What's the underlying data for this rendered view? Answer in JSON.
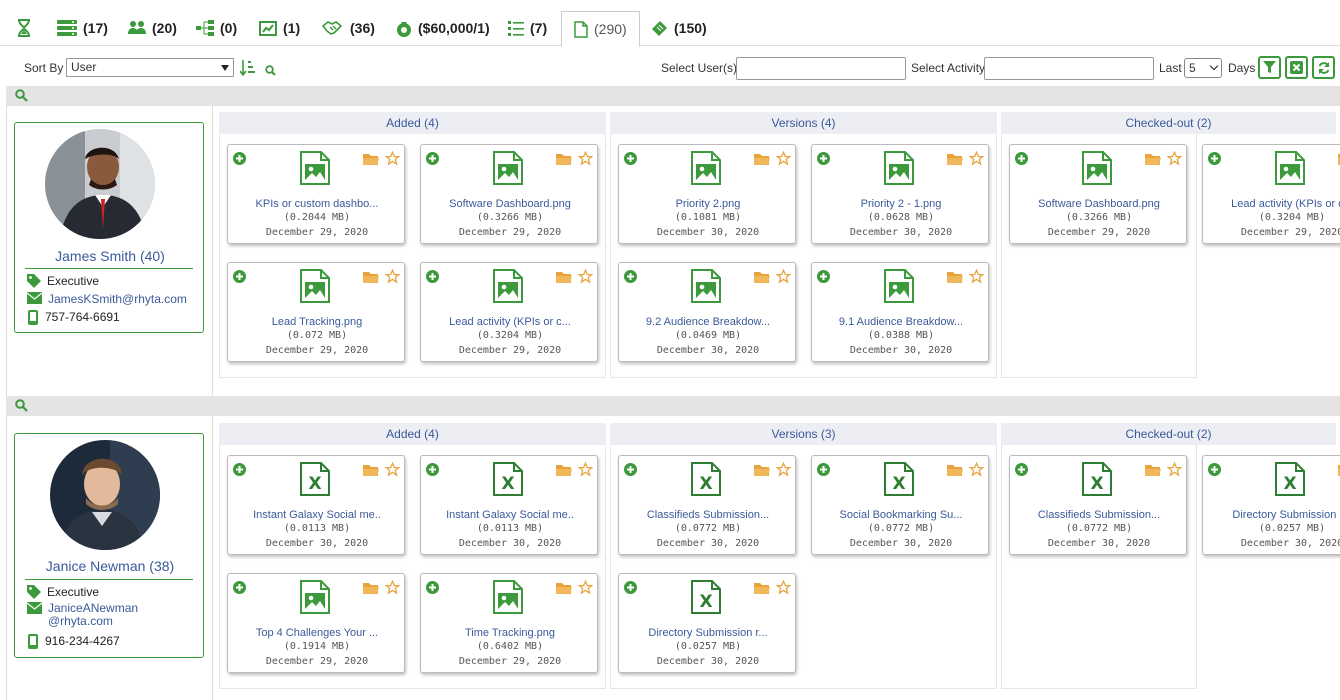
{
  "tabs": [
    {
      "icon": "hourglass-icon",
      "count": ""
    },
    {
      "icon": "list-stack-icon",
      "count": "(17)"
    },
    {
      "icon": "users-icon",
      "count": "(20)"
    },
    {
      "icon": "hierarchy-icon",
      "count": "(0)"
    },
    {
      "icon": "chart-icon",
      "count": "(1)"
    },
    {
      "icon": "handshake-icon",
      "count": "(36)"
    },
    {
      "icon": "money-bag-icon",
      "count": "($60,000/1)"
    },
    {
      "icon": "checklist-icon",
      "count": "(7)"
    },
    {
      "icon": "document-icon",
      "count": "(290)"
    },
    {
      "icon": "ticket-icon",
      "count": "(150)"
    }
  ],
  "toolbar": {
    "sort_label": "Sort By",
    "sort_value": "User",
    "users_label": "Select User(s)",
    "activity_label": "Select Activity",
    "last_label": "Last",
    "days_value": "5",
    "days_label": "Days"
  },
  "users": [
    {
      "name": "James Smith (40)",
      "role": "Executive",
      "email": "JamesKSmith@rhyta.com",
      "phone": "757-764-6691",
      "columns": [
        {
          "title": "Added (4)",
          "cards": [
            {
              "type": "image",
              "name": "KPIs or custom dashbo...",
              "size": "(0.2044 MB)",
              "date": "December 29, 2020"
            },
            {
              "type": "image",
              "name": "Software Dashboard.png",
              "size": "(0.3266 MB)",
              "date": "December 29, 2020"
            },
            {
              "type": "image",
              "name": "Lead Tracking.png",
              "size": "(0.072 MB)",
              "date": "December 29, 2020"
            },
            {
              "type": "image",
              "name": "Lead activity (KPIs or c...",
              "size": "(0.3204 MB)",
              "date": "December 29, 2020"
            }
          ]
        },
        {
          "title": "Versions (4)",
          "cards": [
            {
              "type": "image",
              "name": "Priority 2.png",
              "size": "(0.1081 MB)",
              "date": "December 30, 2020"
            },
            {
              "type": "image",
              "name": "Priority 2 - 1.png",
              "size": "(0.0628 MB)",
              "date": "December 30, 2020"
            },
            {
              "type": "image",
              "name": "9.2 Audience Breakdow...",
              "size": "(0.0469 MB)",
              "date": "December 30, 2020"
            },
            {
              "type": "image",
              "name": "9.1 Audience Breakdow...",
              "size": "(0.0388 MB)",
              "date": "December 30, 2020"
            }
          ]
        },
        {
          "title": "Checked-out (2)",
          "cards": [
            {
              "type": "image",
              "name": "Software Dashboard.png",
              "size": "(0.3266 MB)",
              "date": "December 29, 2020"
            },
            {
              "type": "image",
              "name": "Lead activity (KPIs or c...",
              "size": "(0.3204 MB)",
              "date": "December 29, 2020"
            }
          ]
        }
      ]
    },
    {
      "name": "Janice Newman (38)",
      "role": "Executive",
      "email": "JaniceANewman",
      "email2": "@rhyta.com",
      "phone": "916-234-4267",
      "columns": [
        {
          "title": "Added (4)",
          "cards": [
            {
              "type": "excel",
              "name": "Instant Galaxy Social me..",
              "size": "(0.0113 MB)",
              "date": "December 30, 2020"
            },
            {
              "type": "excel",
              "name": "Instant Galaxy Social me..",
              "size": "(0.0113 MB)",
              "date": "December 30, 2020"
            },
            {
              "type": "image",
              "name": "Top 4 Challenges Your ...",
              "size": "(0.1914 MB)",
              "date": "December 29, 2020"
            },
            {
              "type": "image",
              "name": "Time Tracking.png",
              "size": "(0.6402 MB)",
              "date": "December 29, 2020"
            }
          ]
        },
        {
          "title": "Versions (3)",
          "cards": [
            {
              "type": "excel",
              "name": "Classifieds Submission...",
              "size": "(0.0772 MB)",
              "date": "December 30, 2020"
            },
            {
              "type": "excel",
              "name": "Social Bookmarking Su...",
              "size": "(0.0772 MB)",
              "date": "December 30, 2020"
            },
            {
              "type": "excel",
              "name": "Directory Submission r...",
              "size": "(0.0257 MB)",
              "date": "December 30, 2020"
            }
          ]
        },
        {
          "title": "Checked-out (2)",
          "cards": [
            {
              "type": "excel",
              "name": "Classifieds Submission...",
              "size": "(0.0772 MB)",
              "date": "December 30, 2020"
            },
            {
              "type": "excel",
              "name": "Directory Submission r...",
              "size": "(0.0257 MB)",
              "date": "December 30, 2020"
            }
          ]
        }
      ]
    }
  ],
  "colors": {
    "green": "#3c9a3c",
    "link": "#3a5a9a",
    "star": "#e8a33c"
  }
}
